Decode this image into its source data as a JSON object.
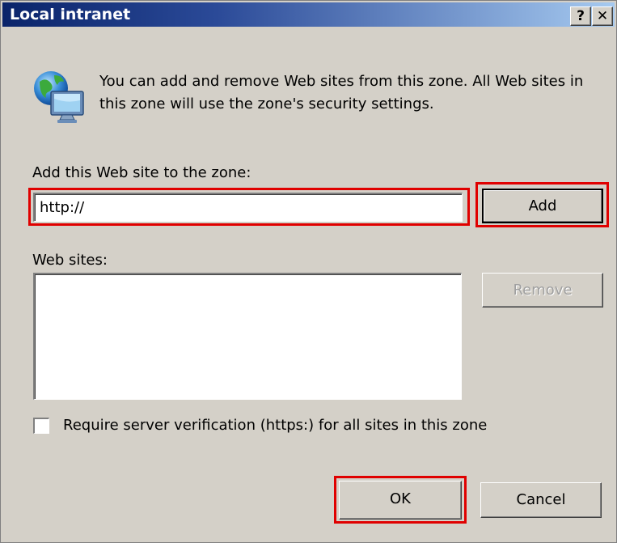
{
  "window": {
    "title": "Local intranet",
    "help_glyph": "?",
    "close_glyph": "✕"
  },
  "info": {
    "icon": "globe-computer-icon",
    "text": "You can add and remove Web sites from this zone. All Web sites in this zone will use the zone's security settings."
  },
  "add_site": {
    "label": "Add this Web site to the zone:",
    "value": "http://",
    "button_label": "Add"
  },
  "web_sites": {
    "label": "Web sites:",
    "items": [],
    "remove_label": "Remove"
  },
  "verification": {
    "label": "Require server verification (https:) for all sites in this zone",
    "checked": false
  },
  "footer": {
    "ok_label": "OK",
    "cancel_label": "Cancel"
  },
  "colors": {
    "dialog_bg": "#d4d0c8",
    "title_bar_start": "#0a246a",
    "title_bar_end": "#a6caf0",
    "highlight": "#e00000",
    "disabled_text": "#a0a0a0"
  }
}
